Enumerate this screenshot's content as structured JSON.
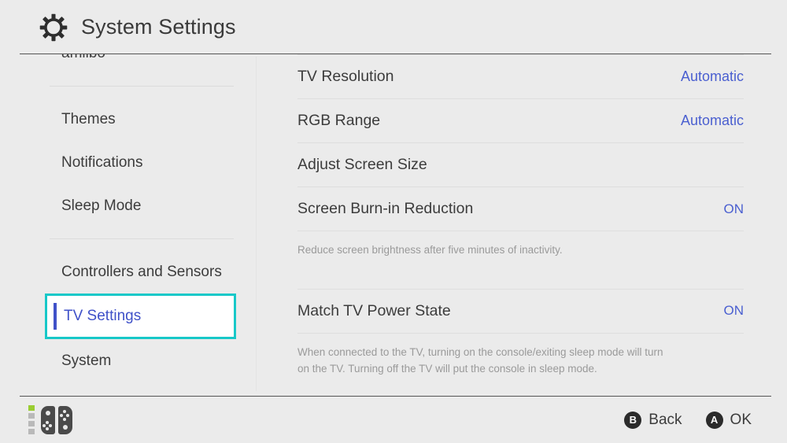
{
  "header": {
    "title": "System Settings",
    "icon": "gear-icon"
  },
  "sidebar": {
    "items": [
      {
        "label": "amiibo",
        "selected": false,
        "clipped": true
      },
      {
        "label": "Themes",
        "selected": false
      },
      {
        "label": "Notifications",
        "selected": false
      },
      {
        "label": "Sleep Mode",
        "selected": false
      },
      {
        "label": "Controllers and Sensors",
        "selected": false
      },
      {
        "label": "TV Settings",
        "selected": true
      },
      {
        "label": "System",
        "selected": false
      }
    ]
  },
  "content": {
    "rows": [
      {
        "label": "TV Resolution",
        "value": "Automatic"
      },
      {
        "label": "RGB Range",
        "value": "Automatic"
      },
      {
        "label": "Adjust Screen Size",
        "value": ""
      },
      {
        "label": "Screen Burn-in Reduction",
        "value": "ON"
      },
      {
        "label": "Match TV Power State",
        "value": "ON"
      }
    ],
    "descriptions": {
      "burn_in": "Reduce screen brightness after five minutes of inactivity.",
      "power_state_line1": "When connected to the TV, turning on the console/exiting sleep mode will turn",
      "power_state_line2": "on the TV. Turning off the TV will put the console in sleep mode."
    }
  },
  "footer": {
    "controller": {
      "icon": "joycon-pair-icon",
      "battery_icon": "battery-level-icon"
    },
    "actions": [
      {
        "glyph": "B",
        "label": "Back"
      },
      {
        "glyph": "A",
        "label": "OK"
      }
    ]
  },
  "colors": {
    "background": "#ebebeb",
    "accent_selected_border": "#17c8c8",
    "accent_value_text": "#4a5fd0",
    "text_primary": "#3c3c3c",
    "text_muted": "#9a9a9a",
    "battery_full": "#9acd32"
  }
}
